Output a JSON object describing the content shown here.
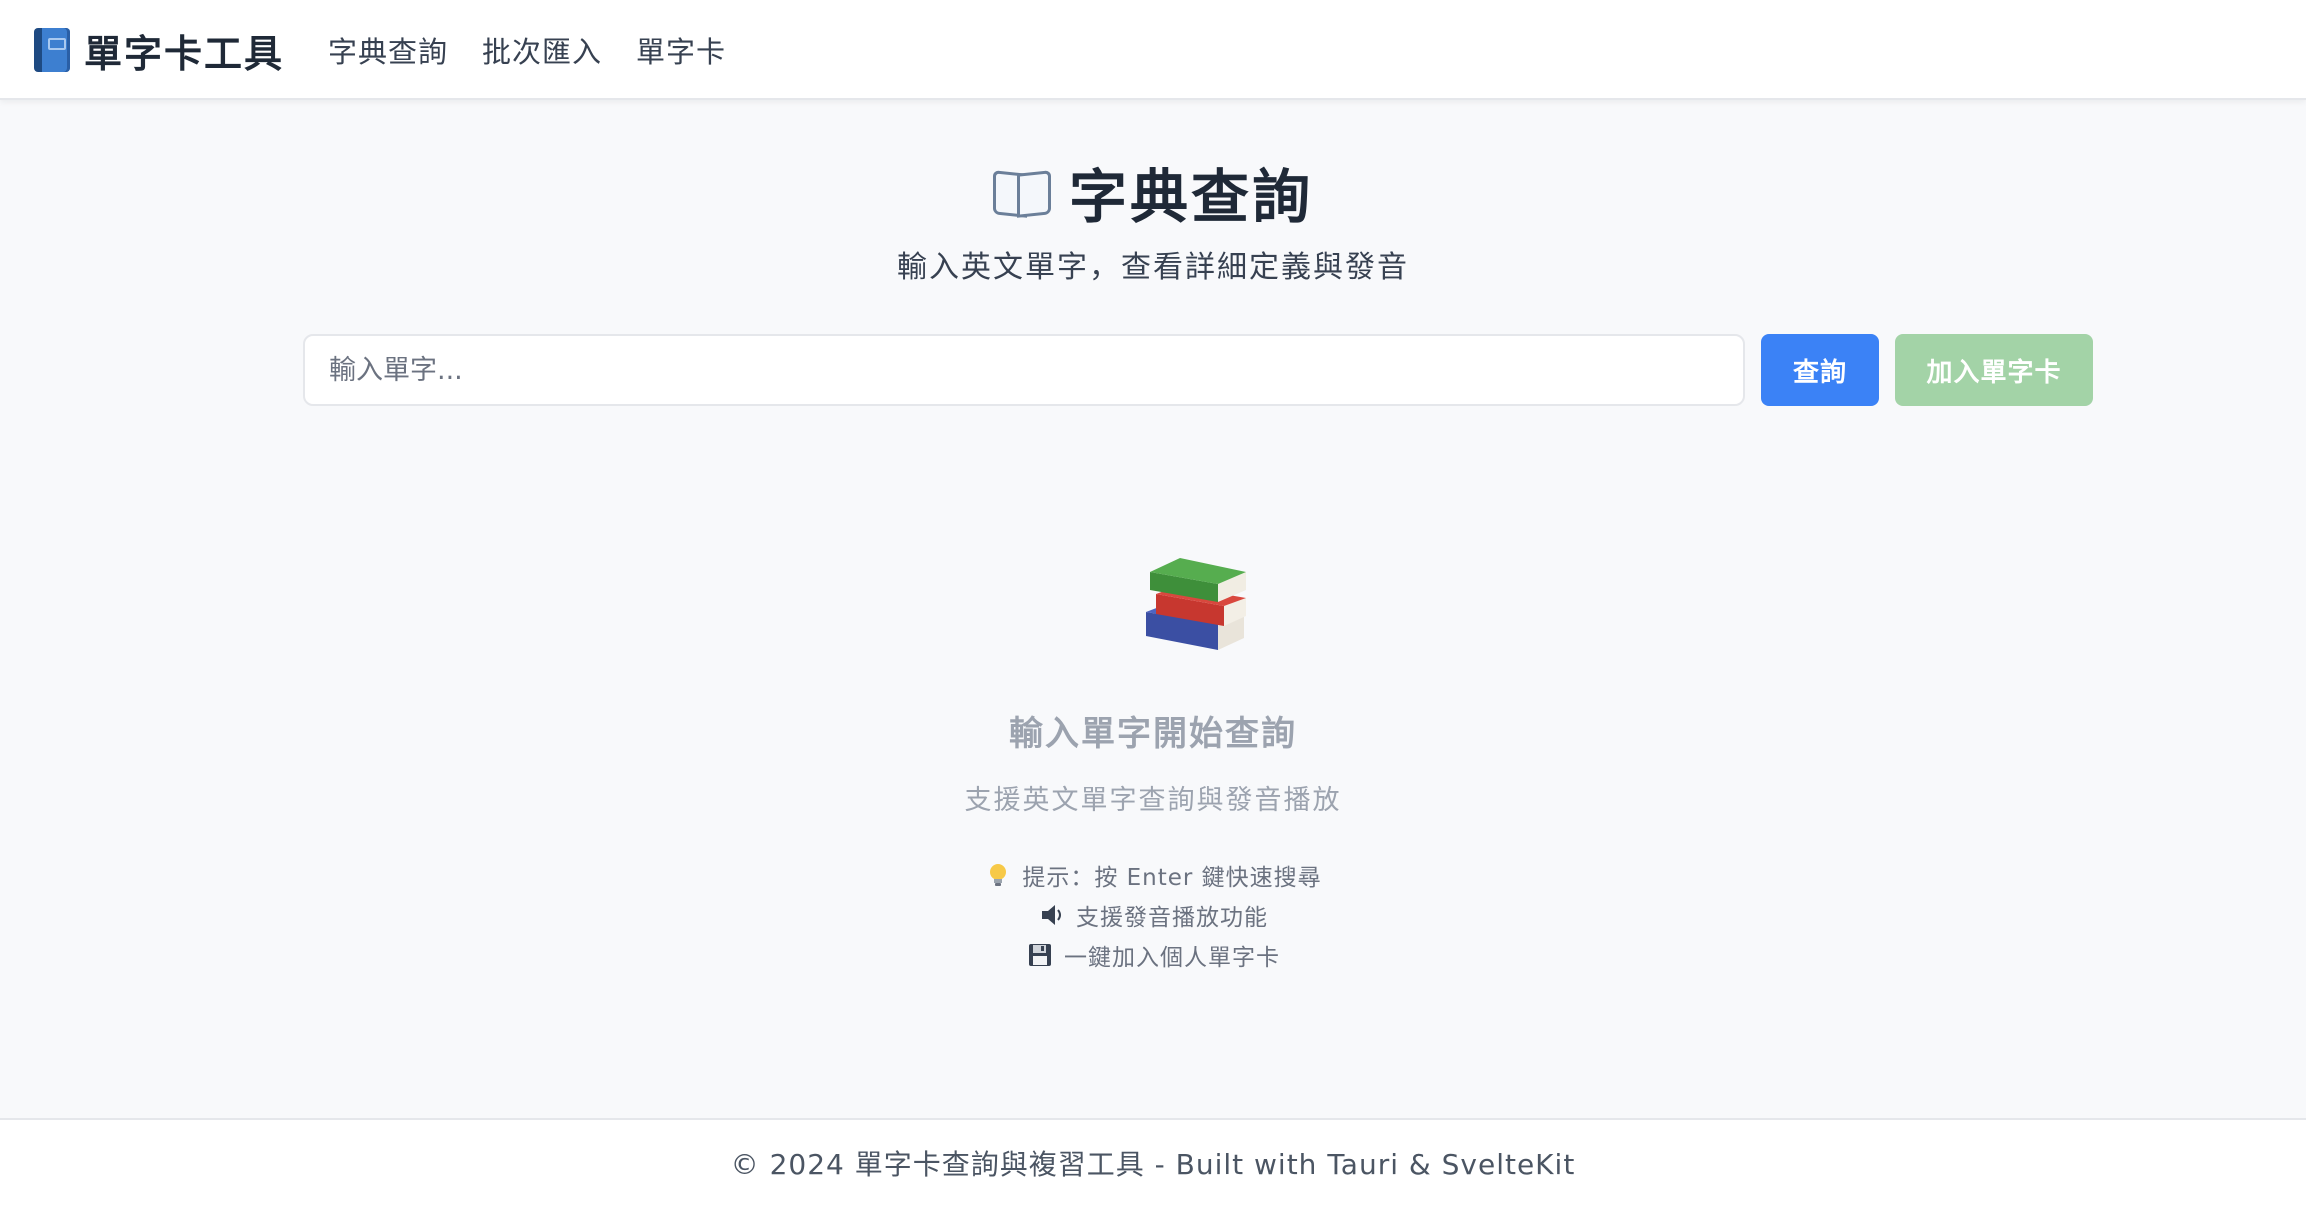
{
  "header": {
    "brand": {
      "icon": "blue-book-icon",
      "title": "單字卡工具"
    },
    "nav": [
      {
        "label": "字典查詢"
      },
      {
        "label": "批次匯入"
      },
      {
        "label": "單字卡"
      }
    ]
  },
  "main": {
    "title_icon": "open-book-icon",
    "title": "字典查詢",
    "subtitle": "輸入英文單字，查看詳細定義與發音",
    "search": {
      "placeholder": "輸入單字...",
      "value": "",
      "search_button": "查詢",
      "add_button": "加入單字卡"
    },
    "empty_state": {
      "icon": "books-icon",
      "title": "輸入單字開始查詢",
      "subtitle": "支援英文單字查詢與發音播放",
      "tips": [
        {
          "icon": "lightbulb-icon",
          "text": "提示：按 Enter 鍵快速搜尋"
        },
        {
          "icon": "speaker-icon",
          "text": "支援發音播放功能"
        },
        {
          "icon": "floppy-disk-icon",
          "text": "一鍵加入個人單字卡"
        }
      ]
    }
  },
  "footer": {
    "text": "© 2024 單字卡查詢與複習工具 - Built with Tauri & SvelteKit"
  },
  "colors": {
    "primary": "#3b82f6",
    "success_disabled": "#a3d3a7",
    "background": "#f8f9fb"
  }
}
